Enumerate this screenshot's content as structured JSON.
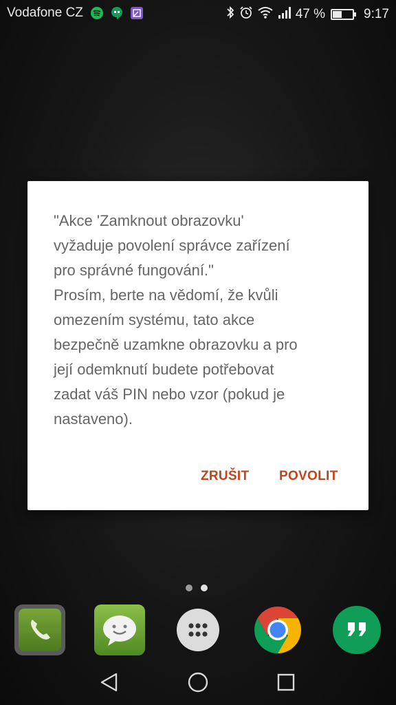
{
  "status_bar": {
    "carrier": "Vodafone CZ",
    "notification_icons": [
      "spotify-icon",
      "hangouts-icon",
      "gallery-icon"
    ],
    "system_icons": [
      "bluetooth-icon",
      "alarm-icon",
      "wifi-icon",
      "signal-icon"
    ],
    "battery_percent_text": "47 %",
    "battery_level": 0.47,
    "time": "9:17"
  },
  "dialog": {
    "message": "\"Akce 'Zamknout obrazovku'\nvyžaduje povolení správce zařízení\npro správné fungování.\"\nProsím, berte na vědomí, že kvůli\nomezením systému, tato akce\nbezpečně uzamkne obrazovku a pro\njejí odemknutí budete potřebovat\nzadat váš PIN nebo vzor (pokud je\nnastaveno).",
    "cancel_label": "ZRUŠIT",
    "allow_label": "POVOLIT",
    "button_color": "#c4431a"
  },
  "home": {
    "page_count": 2,
    "active_page": 2,
    "dock_apps": [
      "phone-icon",
      "messaging-icon",
      "app-drawer-icon",
      "chrome-icon",
      "hangouts-icon"
    ]
  },
  "nav_bar": {
    "buttons": [
      "back-icon",
      "home-icon",
      "recents-icon"
    ]
  }
}
